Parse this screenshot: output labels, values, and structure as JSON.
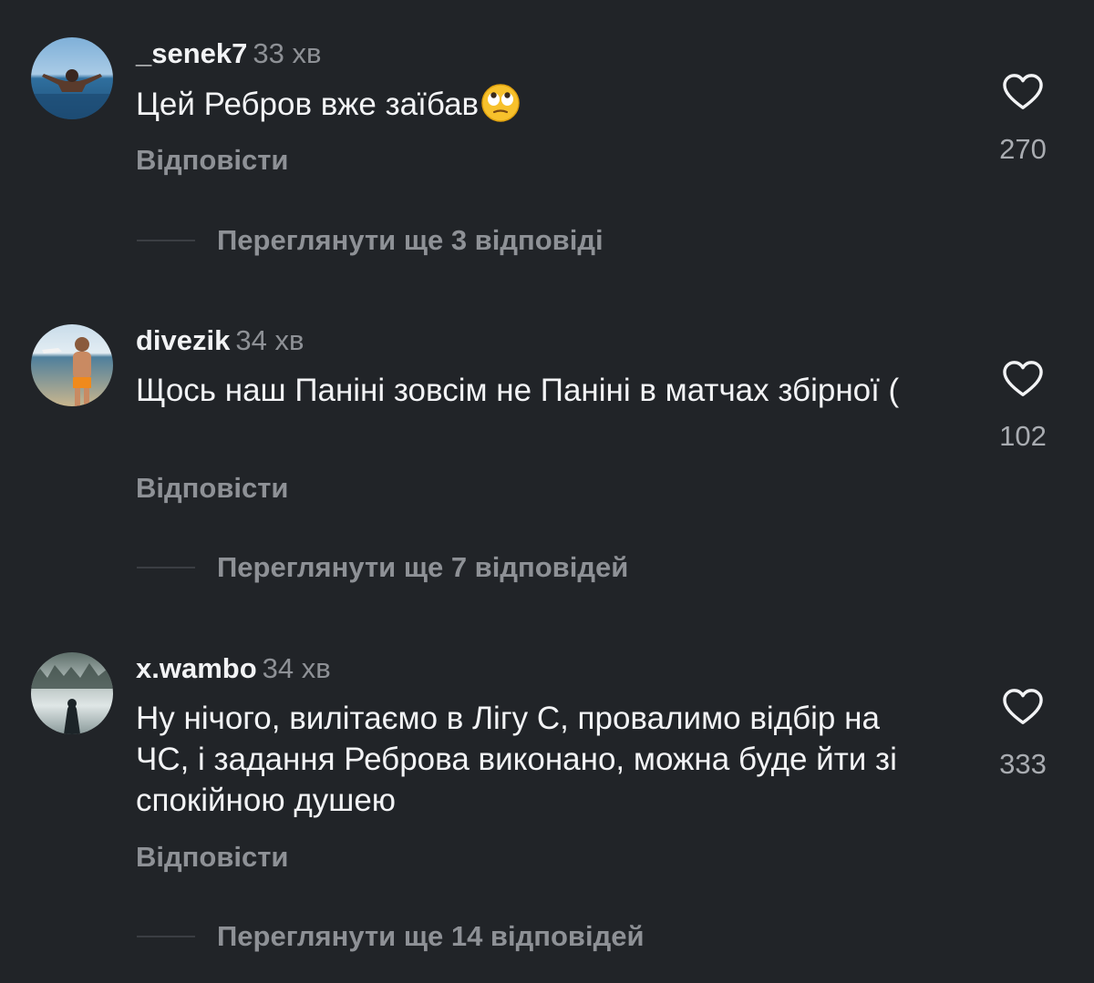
{
  "comments": [
    {
      "username": "_senek7",
      "time": "33 хв",
      "text": "Цей Ребров вже заїбав",
      "emoji": "face-with-rolling-eyes",
      "reply_label": "Відповісти",
      "likes": "270",
      "view_replies": "Переглянути ще 3 відповіді"
    },
    {
      "username": "divezik",
      "time": "34 хв",
      "text": "Щось наш Паніні зовсім не Паніні в матчах збірної (",
      "reply_label": "Відповісти",
      "likes": "102",
      "view_replies": "Переглянути ще 7 відповідей"
    },
    {
      "username": "x.wambo",
      "time": "34 хв",
      "text": "Ну нічого, вилітаємо в Лігу С, провалимо відбір на ЧС, і задання Реброва виконано, можна буде йти зі спокійною душею",
      "reply_label": "Відповісти",
      "likes": "333",
      "view_replies": "Переглянути ще 14 відповідей"
    }
  ],
  "colors": {
    "background": "#212428",
    "text": "#f2f3f5",
    "secondary": "#8e9196"
  },
  "icons": {
    "like": "heart-outline-icon"
  }
}
